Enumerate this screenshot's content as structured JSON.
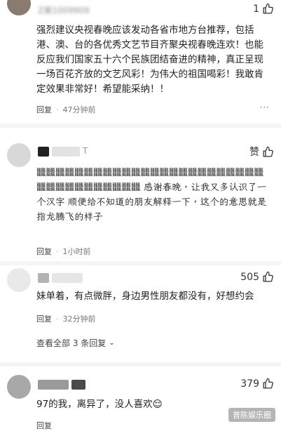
{
  "comments": [
    {
      "username": "Z美1009909",
      "likes": "1",
      "text": "强烈建议央视春晚应该发动各省市地方台推荐，包括港、澳、台的各优秀文艺节目齐聚央视春晚连欢！也能反应我们国家五十六个民族团结奋进的精神，真正呈现一场百花齐放的文艺风彩！为伟大的祖国喝彩！我敢肯定效果非常好！希望能采纳！！",
      "reply_label": "回复",
      "time": "47分钟前"
    },
    {
      "username": "T",
      "likes": "赞",
      "text": "𪚥𪚥𪚥𪚥𪚥𪚥𪚥𪚥𪚥𪚥𪚥𪚥𪚥𪚥𪚥𪚥𪚥𪚥𪚥𪚥𪚥𪚥𪚥𪚥𪚥𪚥𪚥𪚥𪚥𪚥𪚥𪚥𪚥𪚥𪚥 感谢春晚，让我又多认识了一个汉字 顺便给不知道的朋友解释一下，这个的意思就是指龙腾飞的样子",
      "reply_label": "回复",
      "time": "1小时前"
    },
    {
      "username": "",
      "likes": "505",
      "text": "妹单着，有点微胖，身边男性朋友都没有，好想约会",
      "reply_label": "回复",
      "time": "32分钟前",
      "view_all": "查看全部 3 条回复"
    },
    {
      "username": "",
      "likes": "379",
      "text": "97的我，离异了，没人喜欢😌",
      "reply_label": "回复"
    }
  ],
  "watermark": "普陈娱乐圈"
}
